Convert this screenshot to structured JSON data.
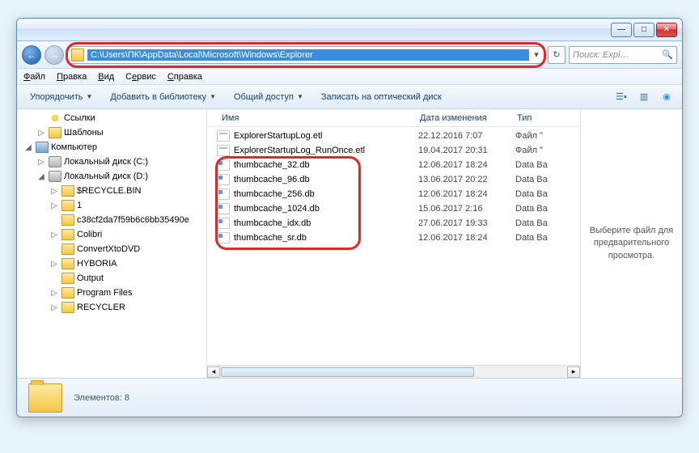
{
  "address_path": "C:\\Users\\ПК\\AppData\\Local\\Microsoft\\Windows\\Explorer",
  "search_placeholder": "Поиск: Expl…",
  "menus": {
    "file": "Файл",
    "edit": "Правка",
    "view": "Вид",
    "tools": "Сервис",
    "help": "Справка"
  },
  "toolbar": {
    "organize": "Упорядочить",
    "library": "Добавить в библиотеку",
    "share": "Общий доступ",
    "burn": "Записать на оптический диск"
  },
  "columns": {
    "name": "Имя",
    "date": "Дата изменения",
    "type": "Тип"
  },
  "tree": [
    {
      "indent": 1,
      "tw": "",
      "icon": "star",
      "label": "Ссылки"
    },
    {
      "indent": 1,
      "tw": "▷",
      "icon": "fold",
      "label": "Шаблоны"
    },
    {
      "indent": 0,
      "tw": "◢",
      "icon": "comp",
      "label": "Компьютер"
    },
    {
      "indent": 1,
      "tw": "▷",
      "icon": "disk",
      "label": "Локальный диск (C:)"
    },
    {
      "indent": 1,
      "tw": "◢",
      "icon": "disk",
      "label": "Локальный диск (D:)"
    },
    {
      "indent": 2,
      "tw": "▷",
      "icon": "fold",
      "label": "$RECYCLE.BIN"
    },
    {
      "indent": 2,
      "tw": "▷",
      "icon": "fold",
      "label": "1"
    },
    {
      "indent": 2,
      "tw": "",
      "icon": "fold",
      "label": "c38cf2da7f59b6c6bb35490e"
    },
    {
      "indent": 2,
      "tw": "▷",
      "icon": "fold",
      "label": "Colibri"
    },
    {
      "indent": 2,
      "tw": "",
      "icon": "fold",
      "label": "ConvertXtoDVD"
    },
    {
      "indent": 2,
      "tw": "▷",
      "icon": "fold",
      "label": "HYBORIA"
    },
    {
      "indent": 2,
      "tw": "",
      "icon": "fold",
      "label": "Output"
    },
    {
      "indent": 2,
      "tw": "▷",
      "icon": "fold",
      "label": "Program Files"
    },
    {
      "indent": 2,
      "tw": "▷",
      "icon": "fold",
      "label": "RECYCLER"
    }
  ],
  "files": [
    {
      "icon": "etl",
      "name": "ExplorerStartupLog.etl",
      "date": "22.12.2016 7:07",
      "type": "Файл \""
    },
    {
      "icon": "etl",
      "name": "ExplorerStartupLog_RunOnce.etl",
      "date": "19.04.2017 20:31",
      "type": "Файл \""
    },
    {
      "icon": "db",
      "name": "thumbcache_32.db",
      "date": "12.06.2017 18:24",
      "type": "Data Ba"
    },
    {
      "icon": "db",
      "name": "thumbcache_96.db",
      "date": "13.06.2017 20:22",
      "type": "Data Ba"
    },
    {
      "icon": "db",
      "name": "thumbcache_256.db",
      "date": "12.06.2017 18:24",
      "type": "Data Ba"
    },
    {
      "icon": "db",
      "name": "thumbcache_1024.db",
      "date": "15.06.2017 2:16",
      "type": "Data Ba"
    },
    {
      "icon": "db",
      "name": "thumbcache_idx.db",
      "date": "27.06.2017 19:33",
      "type": "Data Ba"
    },
    {
      "icon": "db",
      "name": "thumbcache_sr.db",
      "date": "12.06.2017 18:24",
      "type": "Data Ba"
    }
  ],
  "preview_text": "Выберите файл для предварительного просмотра.",
  "status": {
    "label": "Элементов:",
    "count": "8"
  }
}
